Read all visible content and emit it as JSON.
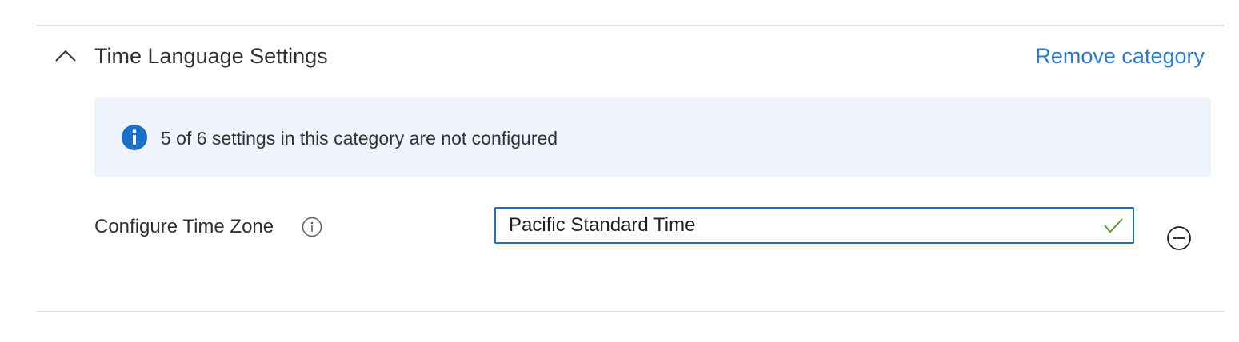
{
  "section": {
    "title": "Time Language Settings",
    "remove_link": "Remove category",
    "collapse_icon": "chevron-up-icon"
  },
  "info_banner": {
    "icon": "info-filled-icon",
    "message": "5 of 6 settings in this category are not configured"
  },
  "setting": {
    "label": "Configure Time Zone",
    "info_icon": "info-outline-icon",
    "value": "Pacific Standard Time",
    "valid_icon": "checkmark-icon",
    "remove_icon": "minus-circle-icon"
  },
  "colors": {
    "link": "#2b7ad2",
    "banner_background": "#eff4fc",
    "info_icon": "#1a6fc9",
    "input_border_focus": "#1a6fc9",
    "checkmark": "#5a9a2e",
    "divider": "#e1dfdd"
  }
}
